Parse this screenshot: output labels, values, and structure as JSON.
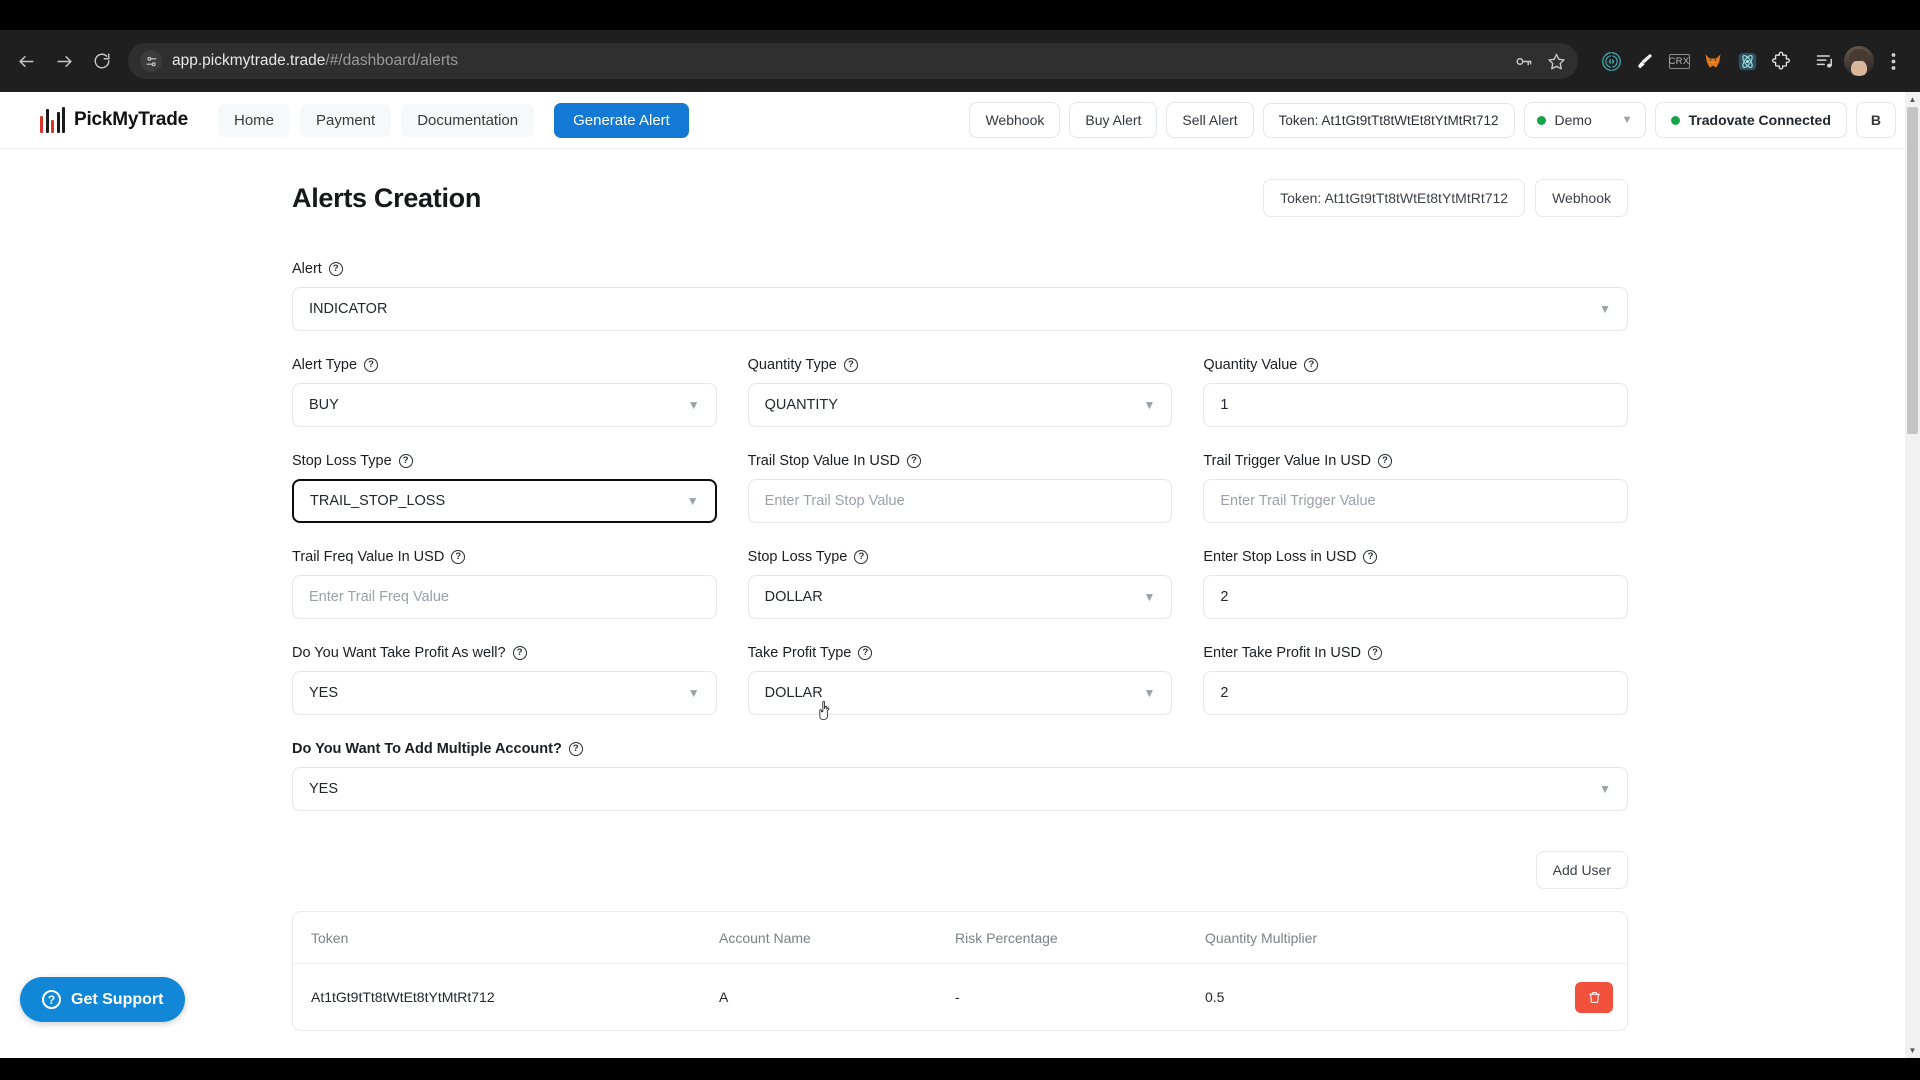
{
  "browser": {
    "url_bold": "app.pickmytrade.trade",
    "url_dim": "/#/dashboard/alerts",
    "back_icon": "back-arrow-icon",
    "forward_icon": "forward-arrow-icon",
    "reload_icon": "reload-icon",
    "site_settings_icon": "site-settings-icon",
    "password_icon": "password-key-icon",
    "bookmark_icon": "bookmark-star-icon",
    "extensions": [
      {
        "name": "tor-browser-extension-icon",
        "label": ""
      },
      {
        "name": "broom-cleaner-extension-icon",
        "label": ""
      },
      {
        "name": "crx-extension-icon",
        "label": "CRX"
      },
      {
        "name": "metamask-fox-extension-icon",
        "label": ""
      },
      {
        "name": "atomic-wallet-extension-icon",
        "label": ""
      },
      {
        "name": "extensions-puzzle-icon",
        "label": ""
      }
    ],
    "reading_list_icon": "reading-list-icon",
    "profile_avatar": "profile-avatar",
    "menu_icon": "kebab-menu-icon"
  },
  "appbar": {
    "brand": "PickMyTrade",
    "brand_colors": [
      "#d9342b",
      "#1a1a1a",
      "#d9342b",
      "#1a1a1a",
      "#1a1a1a"
    ],
    "nav": [
      {
        "label": "Home",
        "name": "nav-home"
      },
      {
        "label": "Payment",
        "name": "nav-payment"
      },
      {
        "label": "Documentation",
        "name": "nav-documentation"
      }
    ],
    "primary_button": "Generate Alert",
    "primary_color": "#1479d4",
    "right": {
      "webhook": "Webhook",
      "buy_alert": "Buy Alert",
      "sell_alert": "Sell Alert",
      "token": "Token: At1tGt9tTt8tWtEt8tYtMtRt712",
      "mode": "Demo",
      "mode_dot_color": "#16a34a",
      "connection": "Tradovate Connected",
      "connection_dot_color": "#16a34a",
      "user_initial": "B"
    }
  },
  "page": {
    "title": "Alerts Creation",
    "header_token": "Token: At1tGt9tTt8tWtEt8tYtMtRt712",
    "header_webhook": "Webhook"
  },
  "form": {
    "alert": {
      "label": "Alert",
      "value": "INDICATOR",
      "type": "select"
    },
    "alert_type": {
      "label": "Alert Type",
      "value": "BUY",
      "type": "select"
    },
    "quantity_type": {
      "label": "Quantity Type",
      "value": "QUANTITY",
      "type": "select"
    },
    "quantity_value": {
      "label": "Quantity Value",
      "value": "1",
      "type": "input"
    },
    "stop_loss_type": {
      "label": "Stop Loss Type",
      "value": "TRAIL_STOP_LOSS",
      "type": "select",
      "focused": true
    },
    "trail_stop_value": {
      "label": "Trail Stop Value In USD",
      "value": "",
      "placeholder": "Enter Trail Stop Value",
      "type": "input"
    },
    "trail_trigger_value": {
      "label": "Trail Trigger Value In USD",
      "value": "",
      "placeholder": "Enter Trail Trigger Value",
      "type": "input"
    },
    "trail_freq_value": {
      "label": "Trail Freq Value In USD",
      "value": "",
      "placeholder": "Enter Trail Freq Value",
      "type": "input"
    },
    "stop_loss_type_2": {
      "label": "Stop Loss Type",
      "value": "DOLLAR",
      "type": "select"
    },
    "stop_loss_usd": {
      "label": "Enter Stop Loss in USD",
      "value": "2",
      "type": "input"
    },
    "take_profit_as_well": {
      "label": "Do You Want Take Profit As well?",
      "value": "YES",
      "type": "select"
    },
    "take_profit_type": {
      "label": "Take Profit Type",
      "value": "DOLLAR",
      "type": "select"
    },
    "take_profit_usd": {
      "label": "Enter Take Profit In USD",
      "value": "2",
      "type": "input"
    },
    "multiple_account": {
      "label": "Do You Want To Add Multiple Account?",
      "value": "YES",
      "type": "select"
    },
    "add_user_button": "Add User"
  },
  "table": {
    "columns": [
      "Token",
      "Account Name",
      "Risk Percentage",
      "Quantity Multiplier",
      ""
    ],
    "rows": [
      {
        "token": "At1tGt9tTt8tWtEt8tYtMtRt712",
        "account_name": "A",
        "risk_percentage": "-",
        "quantity_multiplier": "0.5",
        "action_icon": "trash-delete-icon",
        "action_color": "#f2513d"
      }
    ]
  },
  "support": {
    "label": "Get Support",
    "icon": "question-circle-icon",
    "color": "#1287d8"
  }
}
